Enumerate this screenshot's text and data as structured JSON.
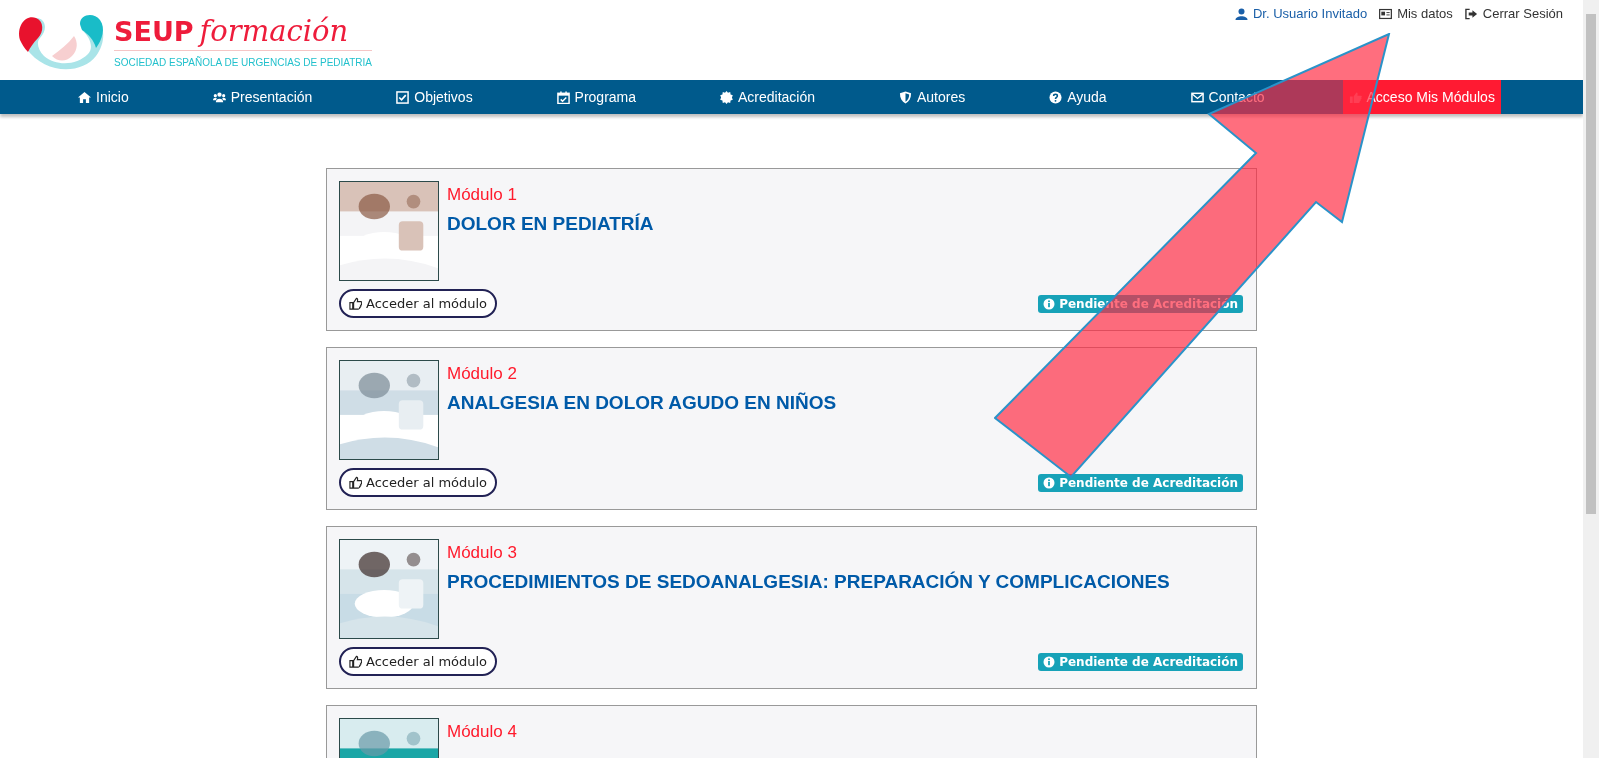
{
  "brand": {
    "name": "SEUP",
    "tagline": "formación",
    "subtitle": "SOCIEDAD ESPAÑOLA DE URGENCIAS DE PEDIATRIA"
  },
  "user_links": [
    {
      "kind": "user",
      "label": "Dr. Usuario Invitado"
    },
    {
      "kind": "card",
      "label": "Mis datos"
    },
    {
      "kind": "logout",
      "label": "Cerrar Sesión"
    }
  ],
  "nav": [
    {
      "kind": "home",
      "label": "Inicio"
    },
    {
      "kind": "users",
      "label": "Presentación"
    },
    {
      "kind": "check",
      "label": "Objetivos"
    },
    {
      "kind": "calendar",
      "label": "Programa"
    },
    {
      "kind": "badge",
      "label": "Acreditación"
    },
    {
      "kind": "shield",
      "label": "Autores"
    },
    {
      "kind": "question",
      "label": "Ayuda"
    },
    {
      "kind": "mail",
      "label": "Contacto"
    },
    {
      "kind": "cta",
      "label": "Acceso Mis Módulos"
    }
  ],
  "modules": [
    {
      "number": "Módulo 1",
      "title": "DOLOR EN PEDIATRÍA",
      "button": "Acceder al módulo",
      "status": "Pendiente de Acreditación"
    },
    {
      "number": "Módulo 2",
      "title": "ANALGESIA EN DOLOR AGUDO EN NIÑOS",
      "button": "Acceder al módulo",
      "status": "Pendiente de Acreditación"
    },
    {
      "number": "Módulo 3",
      "title": "PROCEDIMIENTOS DE SEDOANALGESIA: PREPARACIÓN Y COMPLICACIONES",
      "button": "Acceder al módulo",
      "status": "Pendiente de Acreditación"
    },
    {
      "number": "Módulo 4"
    }
  ]
}
